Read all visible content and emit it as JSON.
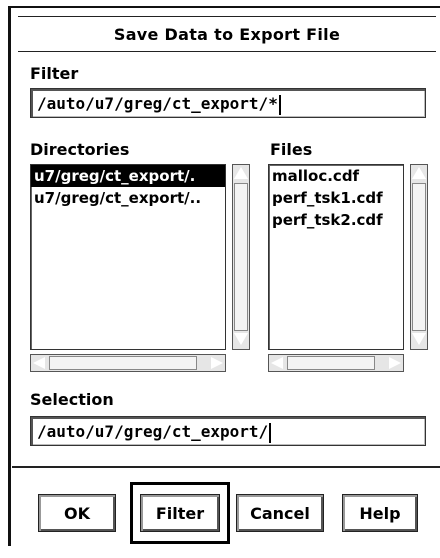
{
  "dialog": {
    "title": "Save Data to Export File",
    "filter_label": "Filter",
    "filter_value": "/auto/u7/greg/ct_export/*",
    "directories_label": "Directories",
    "directories": [
      "u7/greg/ct_export/.",
      "u7/greg/ct_export/.."
    ],
    "selected_directory_index": 0,
    "files_label": "Files",
    "files": [
      "malloc.cdf",
      "perf_tsk1.cdf",
      "perf_tsk2.cdf"
    ],
    "selection_label": "Selection",
    "selection_value": "/auto/u7/greg/ct_export/",
    "buttons": {
      "ok": "OK",
      "filter": "Filter",
      "cancel": "Cancel",
      "help": "Help"
    },
    "default_button": "filter"
  }
}
